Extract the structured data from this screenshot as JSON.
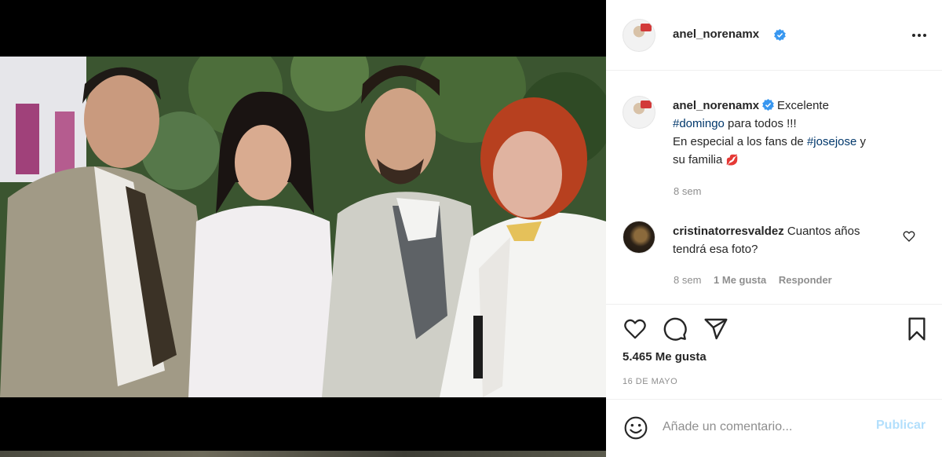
{
  "post": {
    "username": "anel_norenamx",
    "more_icon": "more-horizontal-icon"
  },
  "caption": {
    "username": "anel_norenamx",
    "text_1": "Excelente",
    "tag_domingo": "#domingo",
    "text_2": " para todos !!!",
    "text_3": "En especial a los fans de ",
    "tag_josejose": "#josejose",
    "text_4": " y",
    "text_5": "su familia ",
    "emoji": "💋",
    "age": "8 sem"
  },
  "comment": {
    "username": "cristinatorresvaldez",
    "text_1": " Cuantos años",
    "text_2": "tendrá esa foto?",
    "age": "8 sem",
    "likes": "1 Me gusta",
    "reply": "Responder"
  },
  "actions": {
    "like_icon": "heart-icon",
    "comment_icon": "comment-bubble-icon",
    "share_icon": "send-icon",
    "save_icon": "bookmark-icon"
  },
  "likes_label": "5.465 Me gusta",
  "date": "16 DE MAYO",
  "add_comment": {
    "placeholder": "Añade un comentario...",
    "publish": "Publicar"
  },
  "colors": {
    "link": "#00376b",
    "verified": "#3897f0",
    "publish_disabled": "#b2dffc"
  }
}
